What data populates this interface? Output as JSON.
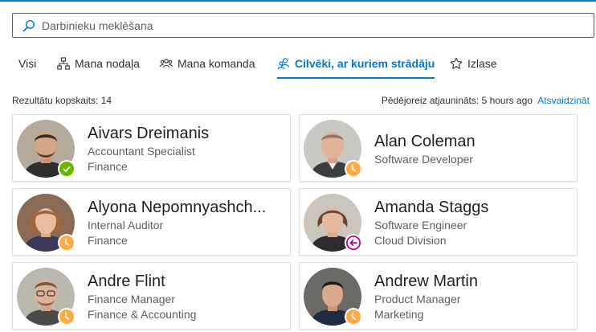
{
  "search": {
    "placeholder": "Darbinieku meklēšana",
    "value": "",
    "icon": "search-icon"
  },
  "tabs": [
    {
      "label": "Visi",
      "icon": "",
      "active": false
    },
    {
      "label": "Mana nodaļa",
      "icon": "org-chart-icon",
      "active": false
    },
    {
      "label": "Mana komanda",
      "icon": "team-icon",
      "active": false
    },
    {
      "label": "Cilvēki, ar kuriem strādāju",
      "icon": "people-icon",
      "active": true
    },
    {
      "label": "Izlase",
      "icon": "star-icon",
      "active": false
    }
  ],
  "results": {
    "total_label": "Rezultātu kopskaits: 14",
    "updated_label": "Pēdējoreiz atjaunināts: 5 hours ago",
    "refresh_label": "Atsvaidzināt"
  },
  "people": [
    {
      "name": "Aivars Dreimanis",
      "title": "Accountant Specialist",
      "department": "Finance",
      "presence": "available"
    },
    {
      "name": "Alan Coleman",
      "title": "Software Developer",
      "department": "",
      "presence": "away"
    },
    {
      "name": "Alyona Nepomnyashch...",
      "title": "Internal Auditor",
      "department": "Finance",
      "presence": "away"
    },
    {
      "name": "Amanda Staggs",
      "title": "Software Engineer",
      "department": "Cloud Division",
      "presence": "out-of-office"
    },
    {
      "name": "Andre Flint",
      "title": "Finance Manager",
      "department": "Finance & Accounting",
      "presence": "away"
    },
    {
      "name": "Andrew Martin",
      "title": "Product Manager",
      "department": "Marketing",
      "presence": "away"
    }
  ],
  "colors": {
    "accent": "#0078d4",
    "available": "#6bb700",
    "away": "#ffaa44",
    "out_of_office": "#b4009e"
  }
}
